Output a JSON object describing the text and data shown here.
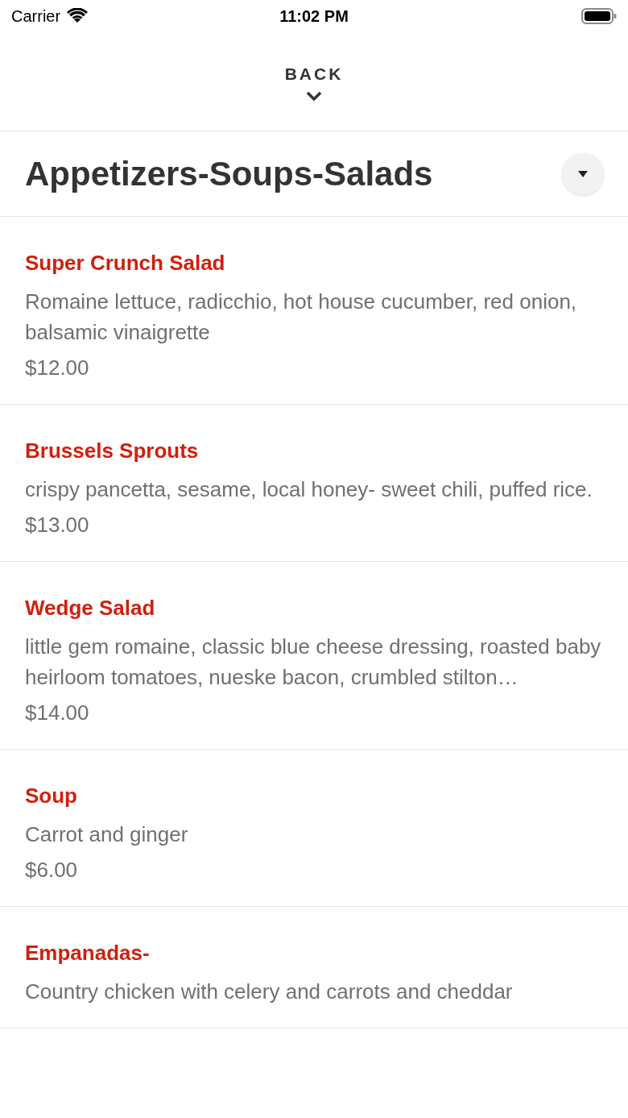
{
  "status_bar": {
    "carrier": "Carrier",
    "time": "11:02 PM"
  },
  "back": {
    "label": "BACK"
  },
  "category": {
    "title": "Appetizers-Soups-Salads"
  },
  "items": [
    {
      "name": "Super Crunch Salad",
      "description": "Romaine lettuce, radicchio, hot house cucumber, red onion, balsamic vinaigrette",
      "price": "$12.00"
    },
    {
      "name": "Brussels Sprouts",
      "description": "crispy pancetta, sesame, local honey- sweet chili, puffed rice.",
      "price": "$13.00"
    },
    {
      "name": "Wedge Salad",
      "description": "little gem romaine, classic blue cheese dressing, roasted baby heirloom tomatoes, nueske bacon, crumbled stilton…",
      "price": "$14.00"
    },
    {
      "name": "Soup",
      "description": "Carrot and ginger",
      "price": "$6.00"
    },
    {
      "name": "Empanadas-",
      "description": "Country chicken with celery and carrots and cheddar"
    }
  ]
}
